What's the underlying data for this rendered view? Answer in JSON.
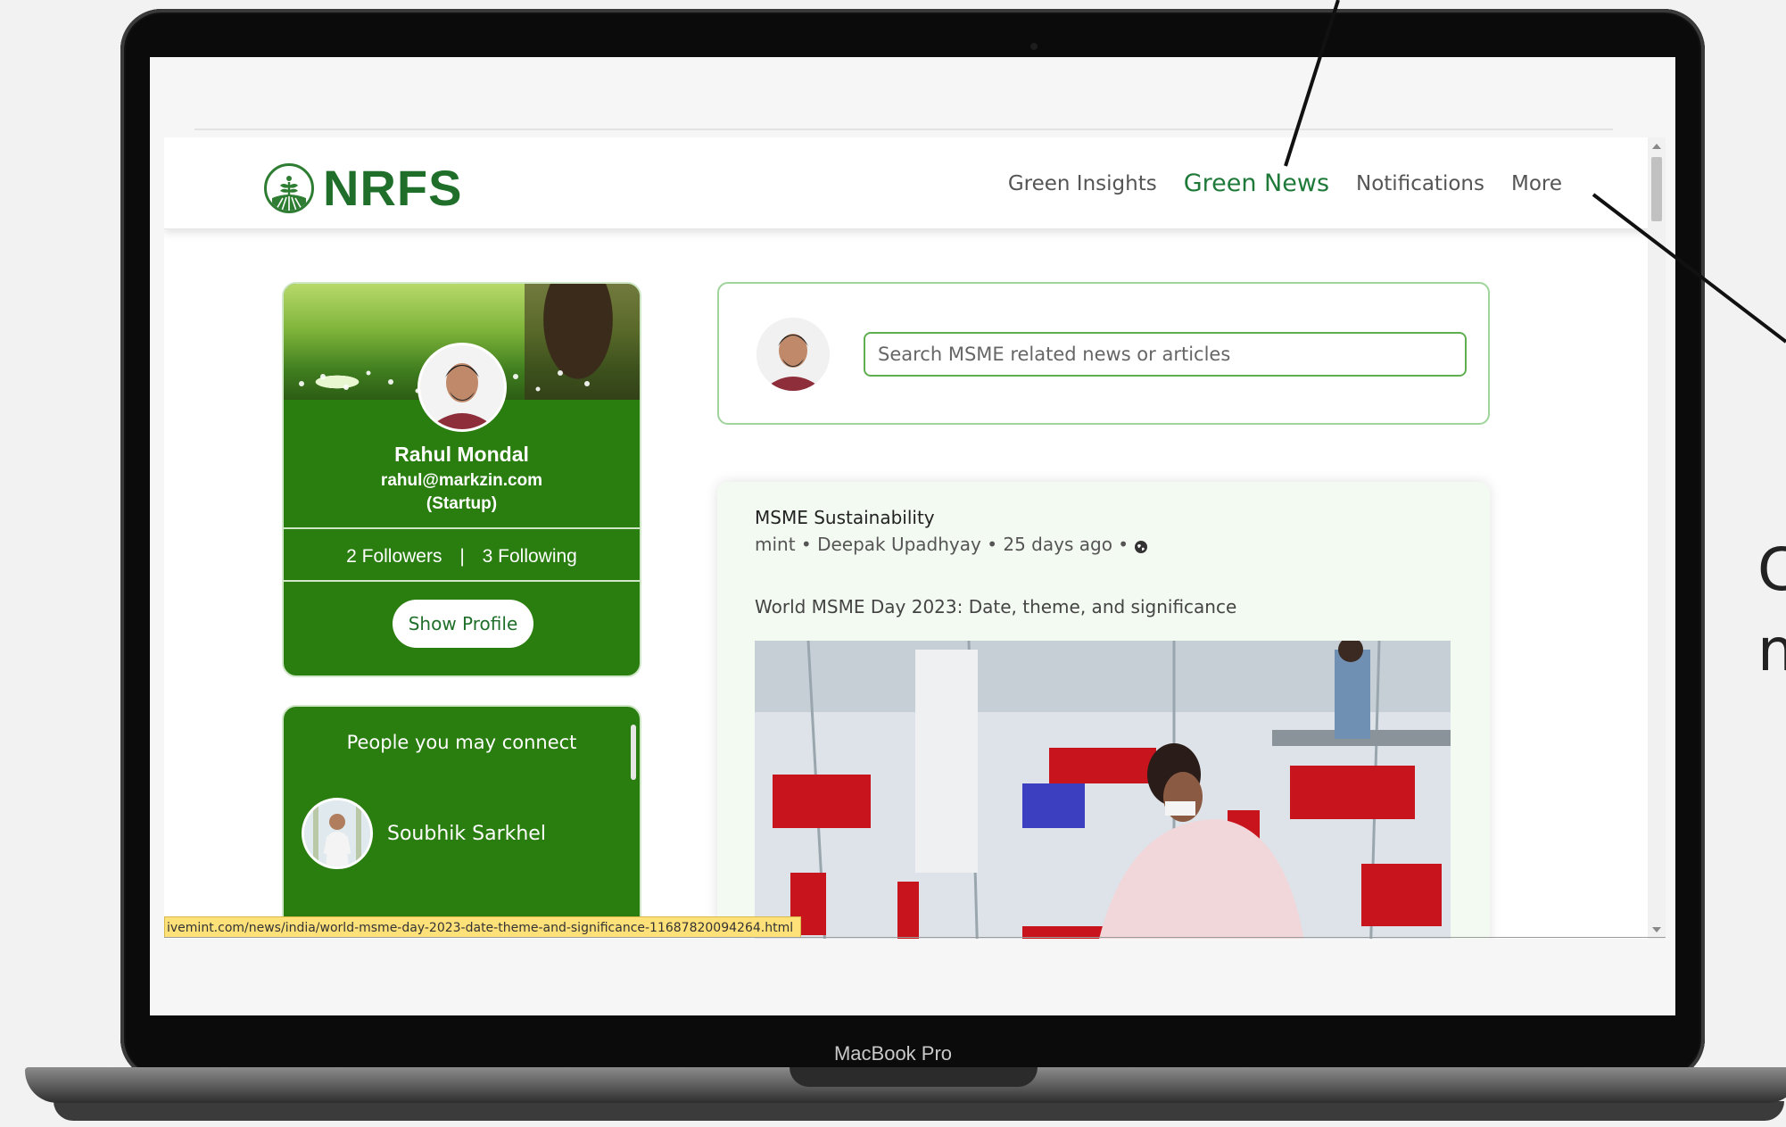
{
  "device": {
    "label": "MacBook Pro"
  },
  "header": {
    "logo_text": "NRFS",
    "nav": [
      {
        "label": "Green Insights",
        "active": false
      },
      {
        "label": "Green News",
        "active": true
      },
      {
        "label": "Notifications",
        "active": false
      },
      {
        "label": "More",
        "active": false
      }
    ]
  },
  "profile": {
    "name": "Rahul Mondal",
    "email": "rahul@markzin.com",
    "type": "(Startup)",
    "followers": "2 Followers",
    "separator": "|",
    "following": "3 Following",
    "show_profile_label": "Show Profile"
  },
  "connect": {
    "title": "People you may connect",
    "people": [
      {
        "name": "Soubhik Sarkhel"
      }
    ]
  },
  "search": {
    "placeholder": "Search MSME related news or articles"
  },
  "news": {
    "category": "MSME Sustainability",
    "meta": "mint • Deepak Upadhyay • 25 days ago •",
    "meta_icon": "globe-icon",
    "headline": "World MSME Day 2023: Date, theme, and significance"
  },
  "status_url": "ivemint.com/news/india/world-msme-day-2023-date-theme-and-significance-11687820094264.html",
  "edge_text": {
    "line1": "C",
    "line2": "n"
  },
  "colors": {
    "brand_green": "#1f6f2a",
    "card_green": "#2a7d0f",
    "border_green": "#9fd49a",
    "status_yellow": "#ffe17a"
  }
}
